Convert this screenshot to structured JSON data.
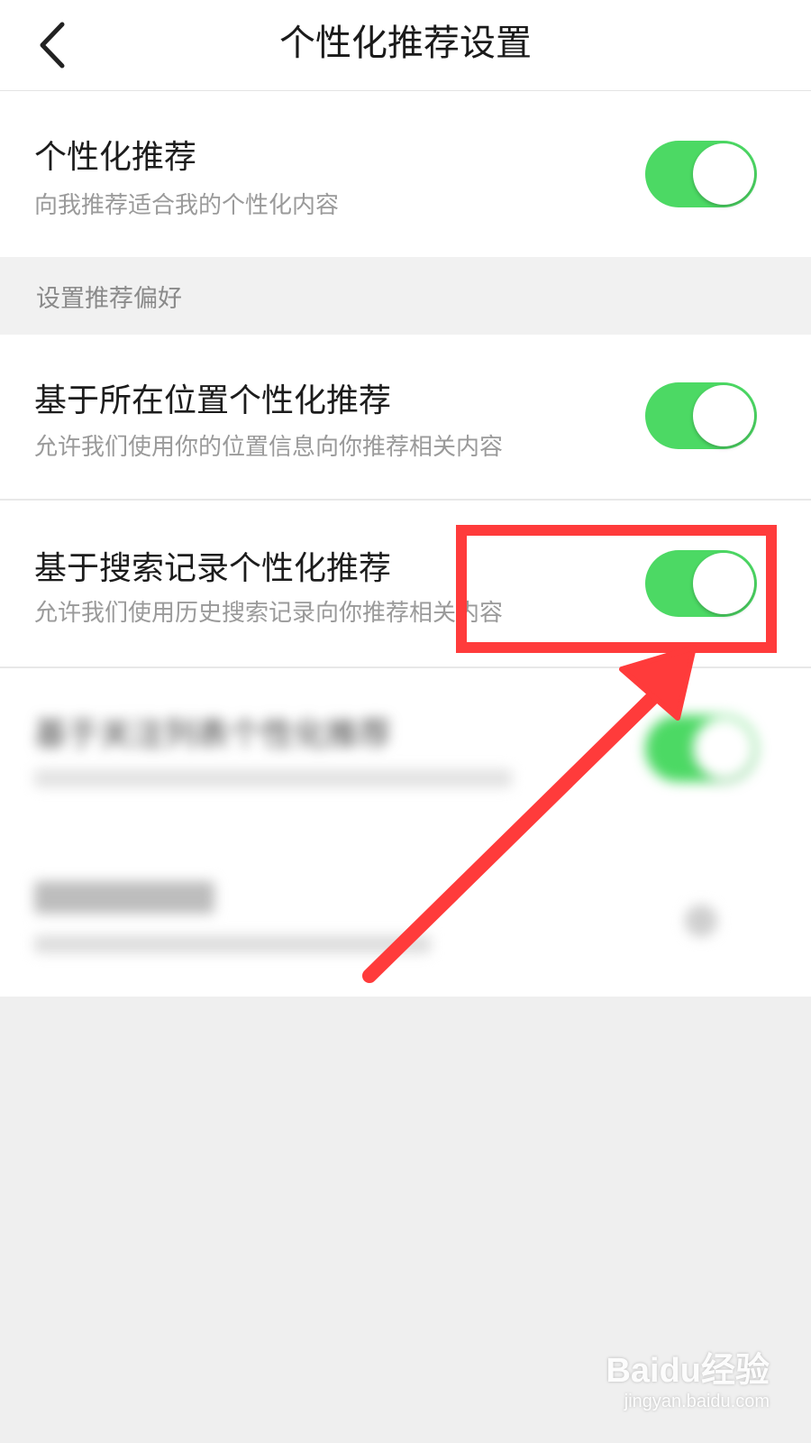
{
  "header": {
    "title": "个性化推荐设置",
    "back_icon": "chevron-left-icon"
  },
  "rows": [
    {
      "title": "个性化推荐",
      "desc": "向我推荐适合我的个性化内容",
      "toggle_on": true
    },
    {
      "title": "基于所在位置个性化推荐",
      "desc": "允许我们使用你的位置信息向你推荐相关内容",
      "toggle_on": true
    },
    {
      "title": "基于搜索记录个性化推荐",
      "desc": "允许我们使用历史搜索记录向你推荐相关内容",
      "toggle_on": true
    },
    {
      "title": "基于关注列表个性化推荐",
      "desc": "",
      "toggle_on": true
    },
    {
      "title": "",
      "desc": "",
      "toggle_on": false
    }
  ],
  "section": {
    "label": "设置推荐偏好"
  },
  "colors": {
    "toggle_on": "#4cd964",
    "annotation": "#ff3b3b",
    "background": "#efefef"
  },
  "watermark": {
    "logo": "Baidu经验",
    "url": "jingyan.baidu.com"
  }
}
